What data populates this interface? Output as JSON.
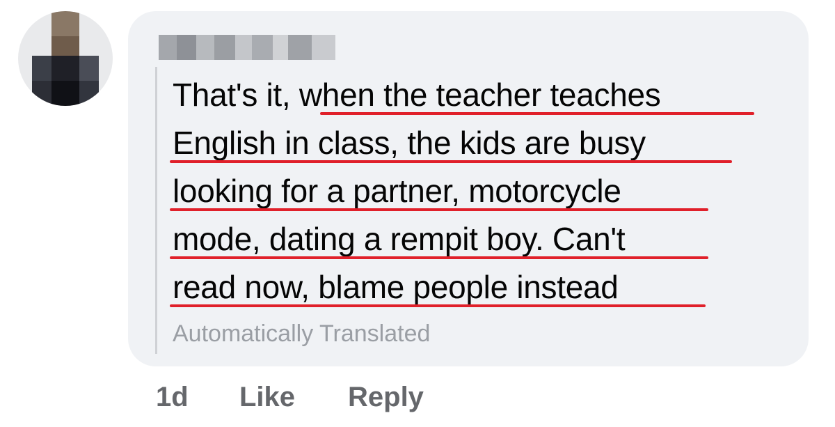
{
  "comment": {
    "author_name": "",
    "text_lines": [
      "That's it, when the teacher teaches",
      "English in class, the kids are busy",
      "looking for a partner, motorcycle",
      "mode, dating a rempit boy. Can't",
      "read now, blame people instead"
    ],
    "translation_note": "Automatically Translated"
  },
  "actions": {
    "timestamp": "1d",
    "like_label": "Like",
    "reply_label": "Reply"
  },
  "colors": {
    "bubble_background": "#f0f2f5",
    "text": "#050505",
    "muted": "#65676b",
    "underline_highlight": "#e0202a"
  }
}
